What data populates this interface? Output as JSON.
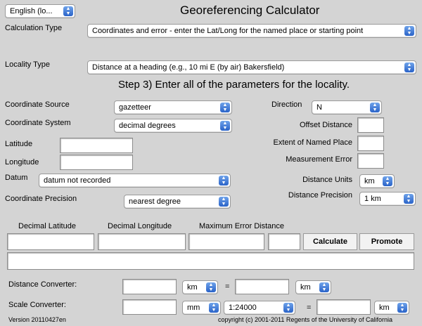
{
  "language_select": "English (lo...",
  "title": "Georeferencing Calculator",
  "calculation_type": {
    "label": "Calculation Type",
    "value": "Coordinates and error - enter the Lat/Long for the named place or starting point"
  },
  "locality_type": {
    "label": "Locality Type",
    "value": "Distance at a heading (e.g., 10 mi E (by air) Bakersfield)"
  },
  "step_heading": "Step 3) Enter all of the parameters for the locality.",
  "left": {
    "coordinate_source": {
      "label": "Coordinate Source",
      "value": "gazetteer"
    },
    "coordinate_system": {
      "label": "Coordinate System",
      "value": "decimal degrees"
    },
    "latitude": {
      "label": "Latitude",
      "value": ""
    },
    "longitude": {
      "label": "Longitude",
      "value": ""
    },
    "datum": {
      "label": "Datum",
      "value": "datum not recorded"
    },
    "coordinate_precision": {
      "label": "Coordinate Precision",
      "value": "nearest degree"
    }
  },
  "right": {
    "direction": {
      "label": "Direction",
      "value": "N"
    },
    "offset_distance": {
      "label": "Offset Distance",
      "value": ""
    },
    "extent_named_place": {
      "label": "Extent of Named Place",
      "value": ""
    },
    "measurement_error": {
      "label": "Measurement Error",
      "value": ""
    },
    "distance_units": {
      "label": "Distance Units",
      "value": "km"
    },
    "distance_precision": {
      "label": "Distance Precision",
      "value": "1 km"
    }
  },
  "results": {
    "decimal_latitude_label": "Decimal Latitude",
    "decimal_longitude_label": "Decimal Longitude",
    "max_error_label": "Maximum Error Distance",
    "calculate_label": "Calculate",
    "promote_label": "Promote"
  },
  "distance_converter": {
    "label": "Distance Converter:",
    "from_unit": "km",
    "equals": "=",
    "to_unit": "km"
  },
  "scale_converter": {
    "label": "Scale Converter:",
    "from_unit": "mm",
    "scale": "1:24000",
    "equals": "=",
    "to_unit": "km"
  },
  "footer": {
    "version": "Version 20110427en",
    "copyright": "copyright (c) 2001-2011 Regents of the University of California"
  },
  "icons": {
    "select_arrows": "up-down-arrows-icon"
  }
}
